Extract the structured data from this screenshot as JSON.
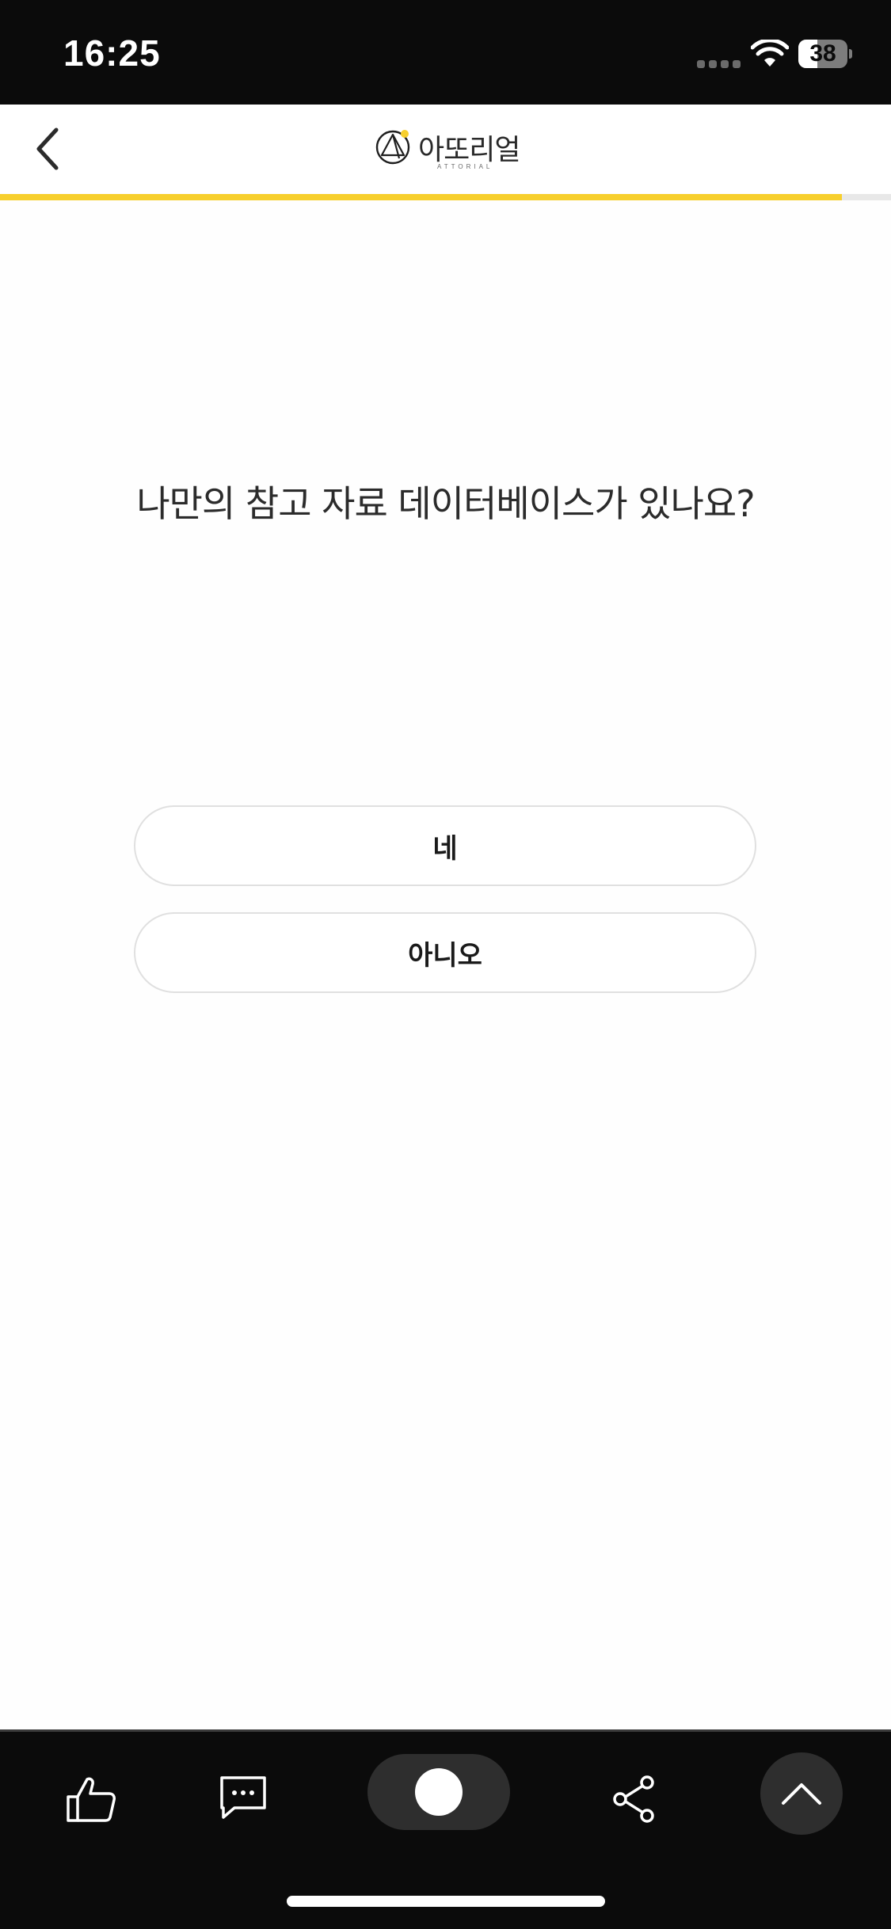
{
  "status_bar": {
    "time": "16:25",
    "battery_level": "38",
    "battery_fraction": 0.38,
    "icons": [
      "signal-dots-icon",
      "wifi-icon",
      "battery-icon"
    ]
  },
  "header": {
    "back_icon": "chevron-left-icon",
    "logo_name": "아또리얼",
    "logo_sub": "ATTORIAL"
  },
  "progress": {
    "fraction": 0.945,
    "color": "#f7cf2d",
    "track_color": "#e8e8e8"
  },
  "question": {
    "text": "나만의 참고 자료 데이터베이스가 있나요?"
  },
  "options": [
    {
      "label": "네"
    },
    {
      "label": "아니오"
    }
  ],
  "bottom_bar": {
    "icons": [
      "thumbs-up-icon",
      "comment-icon",
      "toggle-icon",
      "share-icon",
      "chevron-up-icon"
    ]
  },
  "colors": {
    "accent": "#f7cf2d",
    "dark": "#0b0b0b",
    "text": "#2b2b2b"
  }
}
